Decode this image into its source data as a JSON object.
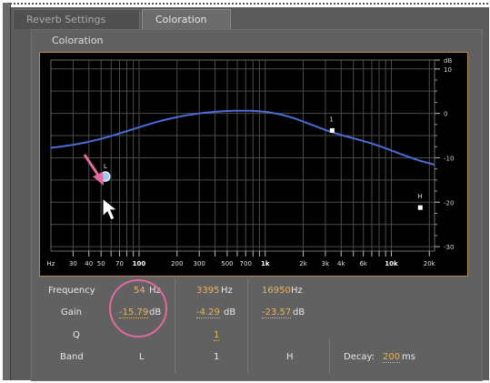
{
  "tabs": [
    {
      "label": "Reverb Settings",
      "active": false
    },
    {
      "label": "Coloration",
      "active": true
    }
  ],
  "panel": {
    "title": "Coloration"
  },
  "graph": {
    "y_unit": "dB",
    "y_ticks": [
      "dB",
      "10",
      "0",
      "-10",
      "-20",
      "-30"
    ],
    "x_ticks": [
      "Hz",
      "30",
      "40",
      "50",
      "70",
      "100",
      "200",
      "300",
      "500",
      "700",
      "1k",
      "2k",
      "3k",
      "4k",
      "6k",
      "10k",
      "20k"
    ],
    "bold_x_ticks": [
      "100",
      "1k",
      "10k"
    ],
    "curve_color": "#4a6dd8",
    "handles": [
      {
        "label": "L",
        "freq_hz": 54,
        "gain_db": -15.79
      },
      {
        "label": "1",
        "freq_hz": 3395,
        "gain_db": -4.29
      },
      {
        "label": "H",
        "freq_hz": 16950,
        "gain_db": -23.57
      }
    ]
  },
  "params": {
    "frequency_label": "Frequency",
    "gain_label": "Gain",
    "q_label": "Q",
    "band_label": "Band",
    "low": {
      "freq": "54",
      "freq_unit": "Hz",
      "gain": "-15.79",
      "gain_unit": "dB",
      "band": "L"
    },
    "mid": {
      "freq": "3395",
      "freq_unit": "Hz",
      "gain": "-4.29",
      "gain_unit": "dB",
      "q": "1",
      "band": "1"
    },
    "high": {
      "freq": "16950",
      "freq_unit": "Hz",
      "gain": "-23.57",
      "gain_unit": "dB",
      "band": "H"
    },
    "decay_label": "Decay:",
    "decay_value": "200",
    "decay_unit": "ms"
  },
  "colors": {
    "value": "#e8b25c",
    "annotation": "#e06aa0",
    "border": "#b8894a"
  }
}
